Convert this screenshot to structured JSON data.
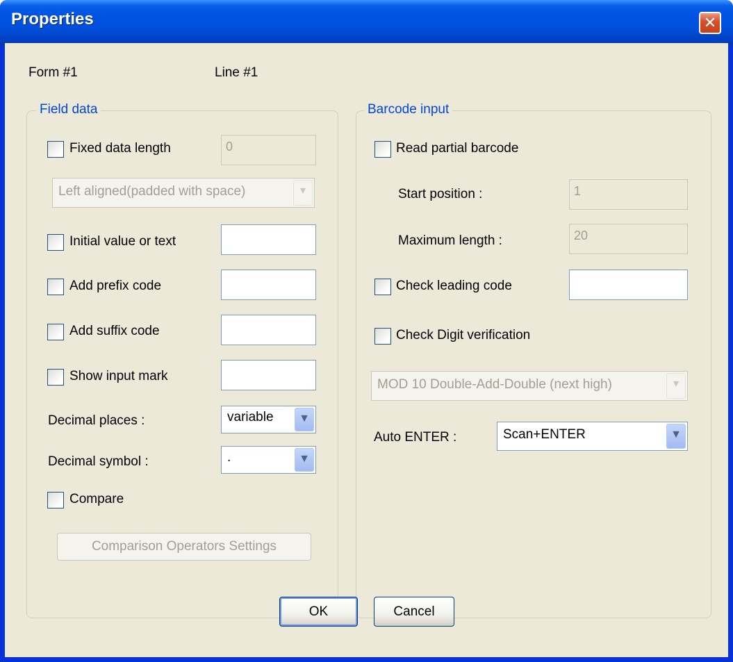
{
  "window": {
    "title": "Properties",
    "close_glyph": "✕"
  },
  "header": {
    "form_label": "Form #1",
    "line_label": "Line #1"
  },
  "field_data": {
    "group_title": "Field data",
    "fixed_length": {
      "label": "Fixed data length",
      "checked": false,
      "value": "0"
    },
    "alignment": {
      "value": "Left aligned(padded with space)",
      "enabled": false
    },
    "initial_value": {
      "label": "Initial value or text",
      "checked": false,
      "value": ""
    },
    "prefix": {
      "label": "Add prefix code",
      "checked": false,
      "value": ""
    },
    "suffix": {
      "label": "Add suffix code",
      "checked": false,
      "value": ""
    },
    "input_mark": {
      "label": "Show input mark",
      "checked": false,
      "value": ""
    },
    "decimal_places": {
      "label": "Decimal places :",
      "value": "variable"
    },
    "decimal_symbol": {
      "label": "Decimal symbol :",
      "value": "."
    },
    "compare": {
      "label": "Compare",
      "checked": false
    },
    "comparison_button": "Comparison Operators Settings"
  },
  "barcode_input": {
    "group_title": "Barcode input",
    "read_partial": {
      "label": "Read partial barcode",
      "checked": false
    },
    "start_position": {
      "label": "Start position :",
      "value": "1"
    },
    "max_length": {
      "label": "Maximum length :",
      "value": "20"
    },
    "leading_code": {
      "label": "Check leading code",
      "checked": false,
      "value": ""
    },
    "check_digit": {
      "label": "Check Digit verification",
      "checked": false
    },
    "check_digit_method": {
      "value": "MOD 10 Double-Add-Double (next high)",
      "enabled": false
    },
    "auto_enter": {
      "label": "Auto ENTER :",
      "value": "Scan+ENTER"
    }
  },
  "buttons": {
    "ok": "OK",
    "cancel": "Cancel"
  },
  "colors": {
    "titlebar": "#0054e3",
    "client_bg": "#ece9d8",
    "group_title": "#0046d5",
    "disabled_text": "#a19f91"
  },
  "icons": {
    "close": "close-icon",
    "dropdown": "chevron-down-icon"
  }
}
